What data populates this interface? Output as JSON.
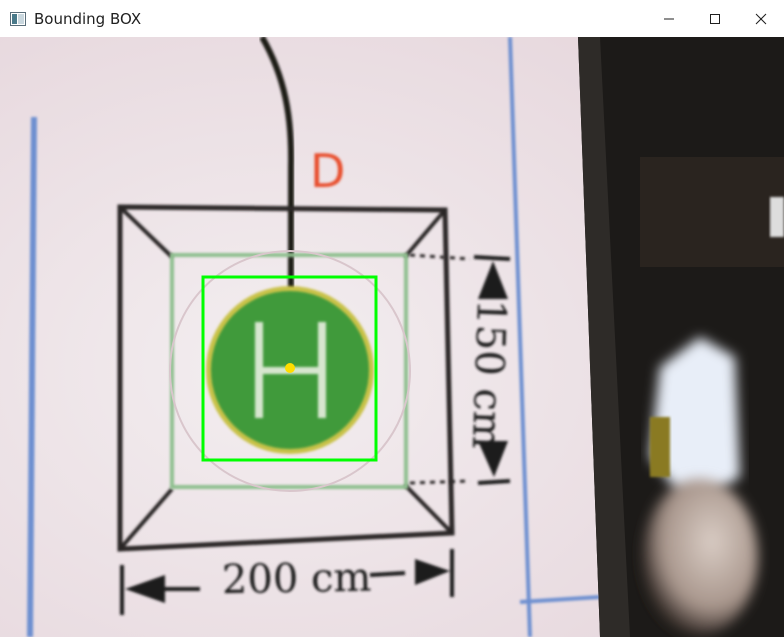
{
  "window": {
    "title": "Bounding BOX",
    "app_icon": "opencv-window-icon",
    "controls": {
      "minimize_icon": "minimize-icon",
      "maximize_icon": "maximize-icon",
      "close_icon": "close-icon"
    }
  },
  "camera_frame": {
    "marker_letter": "D",
    "helipad_letter": "H",
    "width_label": "200 cm",
    "height_label": "150 cm",
    "bounding_box_color": "#00ff00",
    "center_point_color": "#ffdd00",
    "helipad_color": "#3f9a3a"
  }
}
